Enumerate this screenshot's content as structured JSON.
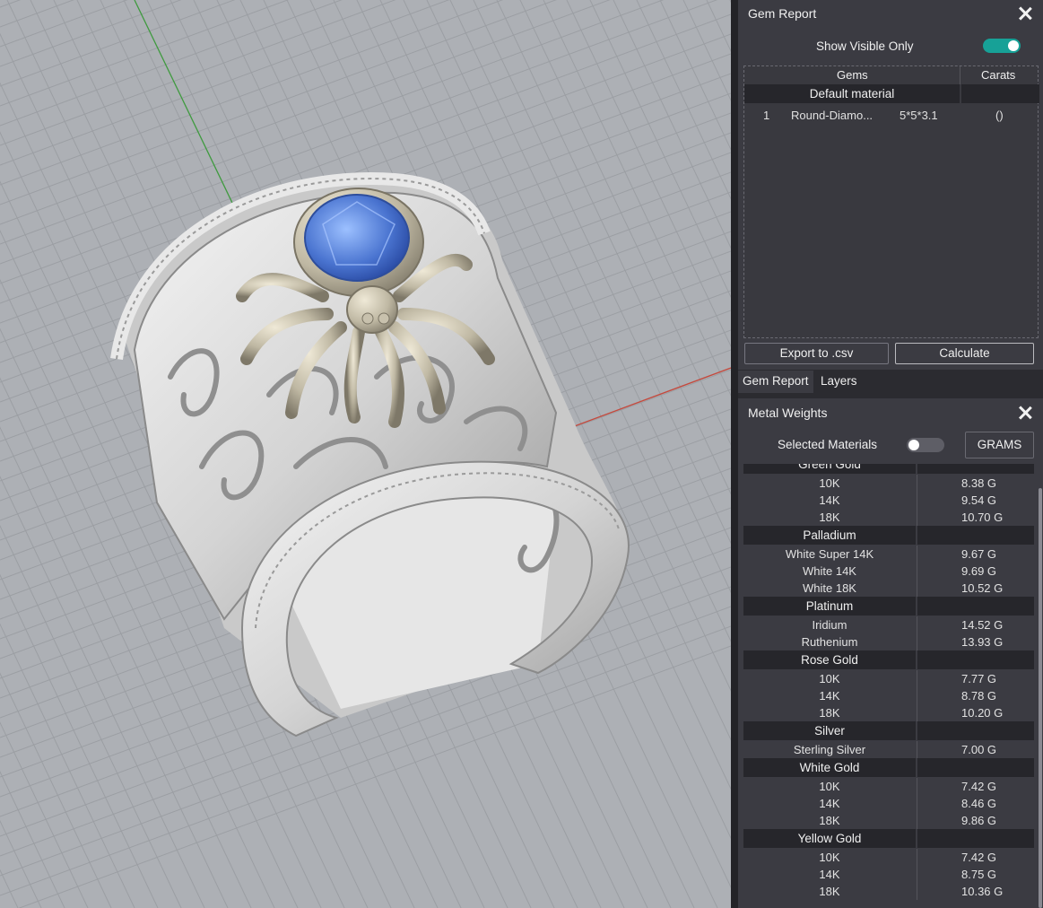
{
  "gem_report": {
    "title": "Gem Report",
    "show_visible_label": "Show Visible Only",
    "show_visible_on": true,
    "columns": {
      "gems": "Gems",
      "carats": "Carats"
    },
    "group": "Default material",
    "rows": [
      {
        "index": "1",
        "name": "Round-Diamo...",
        "size": "5*5*3.1",
        "carats": "()"
      }
    ],
    "export_label": "Export to .csv",
    "calculate_label": "Calculate"
  },
  "tabs": {
    "gem_report": "Gem Report",
    "layers": "Layers"
  },
  "metal_weights": {
    "title": "Metal Weights",
    "selected_materials_label": "Selected Materials",
    "selected_materials_on": false,
    "units_label": "GRAMS",
    "groups": [
      {
        "name": "Green Gold",
        "items": [
          {
            "name": "10K",
            "value": "8.38 G"
          },
          {
            "name": "14K",
            "value": "9.54 G"
          },
          {
            "name": "18K",
            "value": "10.70 G"
          }
        ]
      },
      {
        "name": "Palladium",
        "items": [
          {
            "name": "White Super 14K",
            "value": "9.67 G"
          },
          {
            "name": "White 14K",
            "value": "9.69 G"
          },
          {
            "name": "White 18K",
            "value": "10.52 G"
          }
        ]
      },
      {
        "name": "Platinum",
        "items": [
          {
            "name": "Iridium",
            "value": "14.52 G"
          },
          {
            "name": "Ruthenium",
            "value": "13.93 G"
          }
        ]
      },
      {
        "name": "Rose Gold",
        "items": [
          {
            "name": "10K",
            "value": "7.77 G"
          },
          {
            "name": "14K",
            "value": "8.78 G"
          },
          {
            "name": "18K",
            "value": "10.20 G"
          }
        ]
      },
      {
        "name": "Silver",
        "items": [
          {
            "name": "Sterling Silver",
            "value": "7.00 G"
          }
        ]
      },
      {
        "name": "White Gold",
        "items": [
          {
            "name": "10K",
            "value": "7.42 G"
          },
          {
            "name": "14K",
            "value": "8.46 G"
          },
          {
            "name": "18K",
            "value": "9.86 G"
          }
        ]
      },
      {
        "name": "Yellow Gold",
        "items": [
          {
            "name": "10K",
            "value": "7.42 G"
          },
          {
            "name": "14K",
            "value": "8.75 G"
          },
          {
            "name": "18K",
            "value": "10.36 G"
          }
        ]
      }
    ]
  },
  "colors": {
    "viewport_bg": "#adb0b5",
    "grid": "#9a9da2",
    "metal": "#dcdcdc",
    "spider": "#bfb8a3",
    "gem": "#4a74d0",
    "toggle_on": "#17a197",
    "panel_bg": "#3b3b42"
  }
}
